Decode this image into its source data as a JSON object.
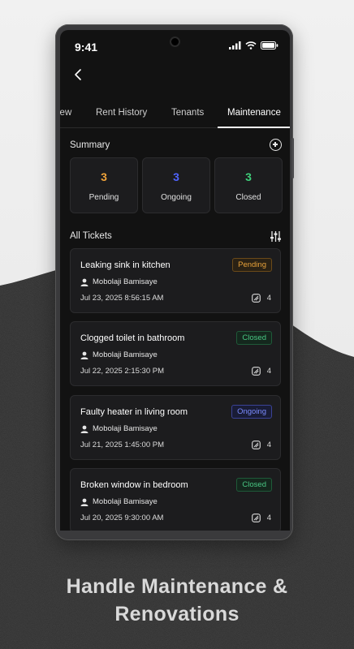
{
  "status_bar": {
    "time": "9:41"
  },
  "tabs": [
    {
      "label": "iew"
    },
    {
      "label": "Rent History"
    },
    {
      "label": "Tenants"
    },
    {
      "label": "Maintenance",
      "active": true
    }
  ],
  "summary": {
    "title": "Summary",
    "cards": [
      {
        "count": "3",
        "label": "Pending",
        "color": "#f0a33a"
      },
      {
        "count": "3",
        "label": "Ongoing",
        "color": "#4f63ff"
      },
      {
        "count": "3",
        "label": "Closed",
        "color": "#3ecf7a"
      }
    ]
  },
  "tickets_section": {
    "title": "All Tickets"
  },
  "tickets": [
    {
      "title": "Leaking sink in kitchen",
      "status": "Pending",
      "tenant": "Mobolaji Bamisaye",
      "datetime": "Jul 23, 2025  8:56:15 AM",
      "images": "4"
    },
    {
      "title": "Clogged toilet in bathroom",
      "status": "Closed",
      "tenant": "Mobolaji Bamisaye",
      "datetime": "Jul 22, 2025 2:15:30 PM",
      "images": "4"
    },
    {
      "title": "Faulty heater in living room",
      "status": "Ongoing",
      "tenant": "Mobolaji Bamisaye",
      "datetime": "Jul 21, 2025 1:45:00 PM",
      "images": "4"
    },
    {
      "title": "Broken window in bedroom",
      "status": "Closed",
      "tenant": "Mobolaji Bamisaye",
      "datetime": "Jul 20, 2025 9:30:00 AM",
      "images": "4"
    }
  ],
  "caption": {
    "line1": "Handle Maintenance &",
    "line2": "Renovations"
  },
  "colors": {
    "pending": "#e8a23a",
    "closed": "#49c783",
    "ongoing": "#7b8cff",
    "screen_bg": "#121212"
  }
}
